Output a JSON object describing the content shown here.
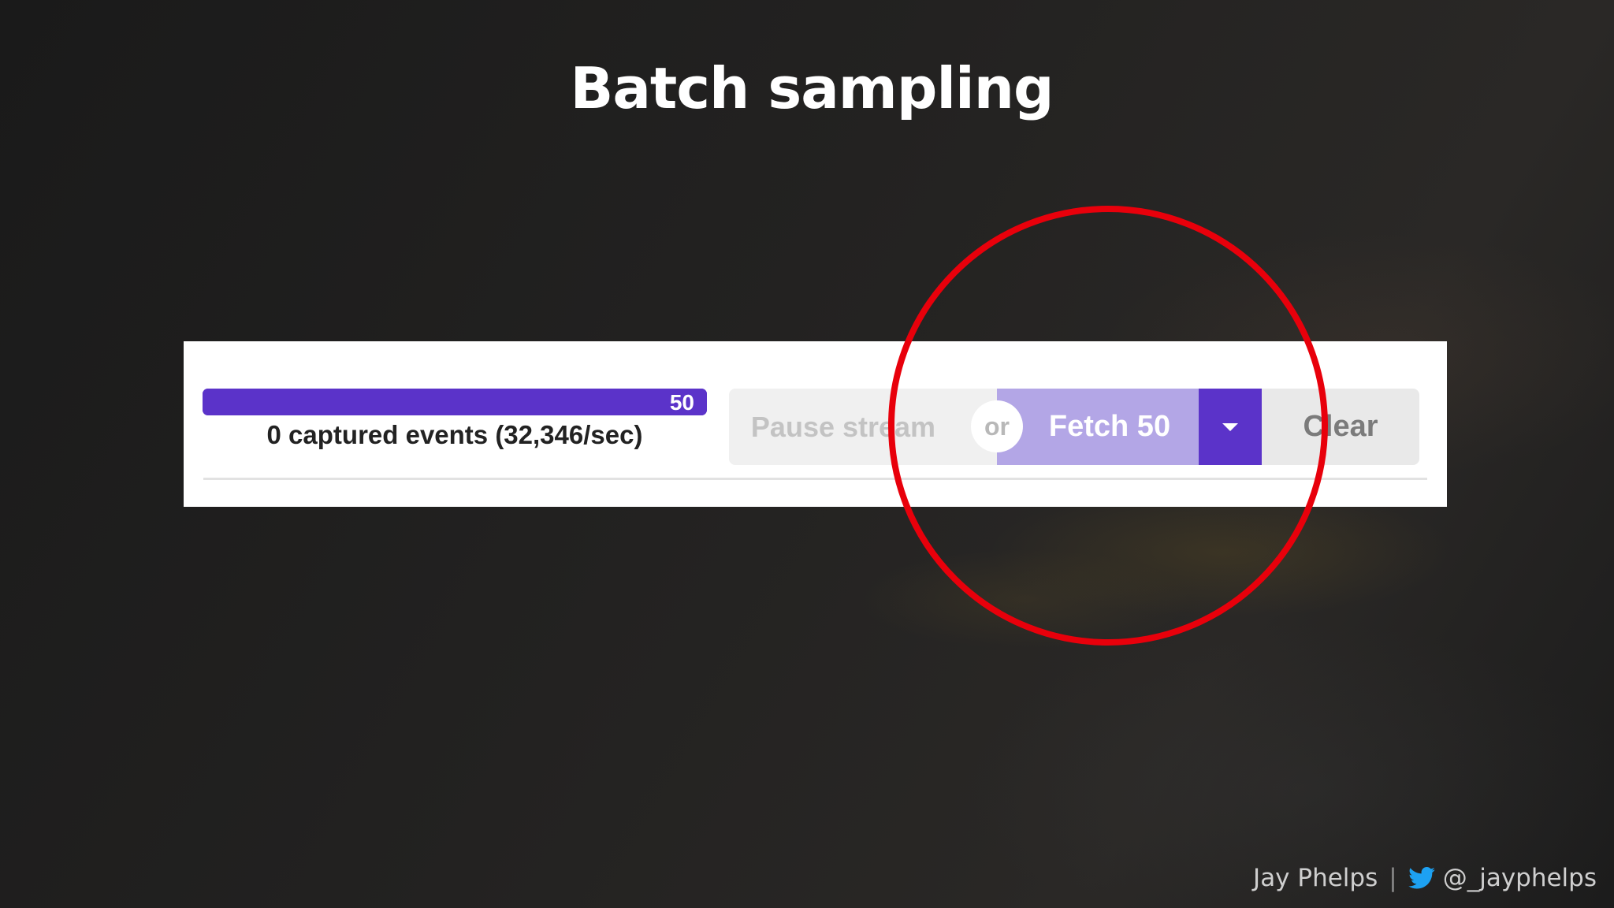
{
  "slide": {
    "title": "Batch sampling"
  },
  "panel": {
    "progress": {
      "label": "50",
      "fill_fraction": 1.0,
      "color": "#5b33c9"
    },
    "captured_events_text": "0 captured events (32,346/sec)",
    "buttons": {
      "pause_label": "Pause stream",
      "or_label": "or",
      "fetch_label": "Fetch 50",
      "caret_icon": "chevron-down-icon",
      "clear_label": "Clear"
    },
    "accent_color": "#5b33c9",
    "fetch_color": "#b3a6e6"
  },
  "annotation": {
    "circle_color": "#e8000b"
  },
  "footer": {
    "author": "Jay Phelps",
    "separator": "|",
    "twitter_icon": "twitter-bird-icon",
    "twitter_handle": "@_jayphelps"
  }
}
